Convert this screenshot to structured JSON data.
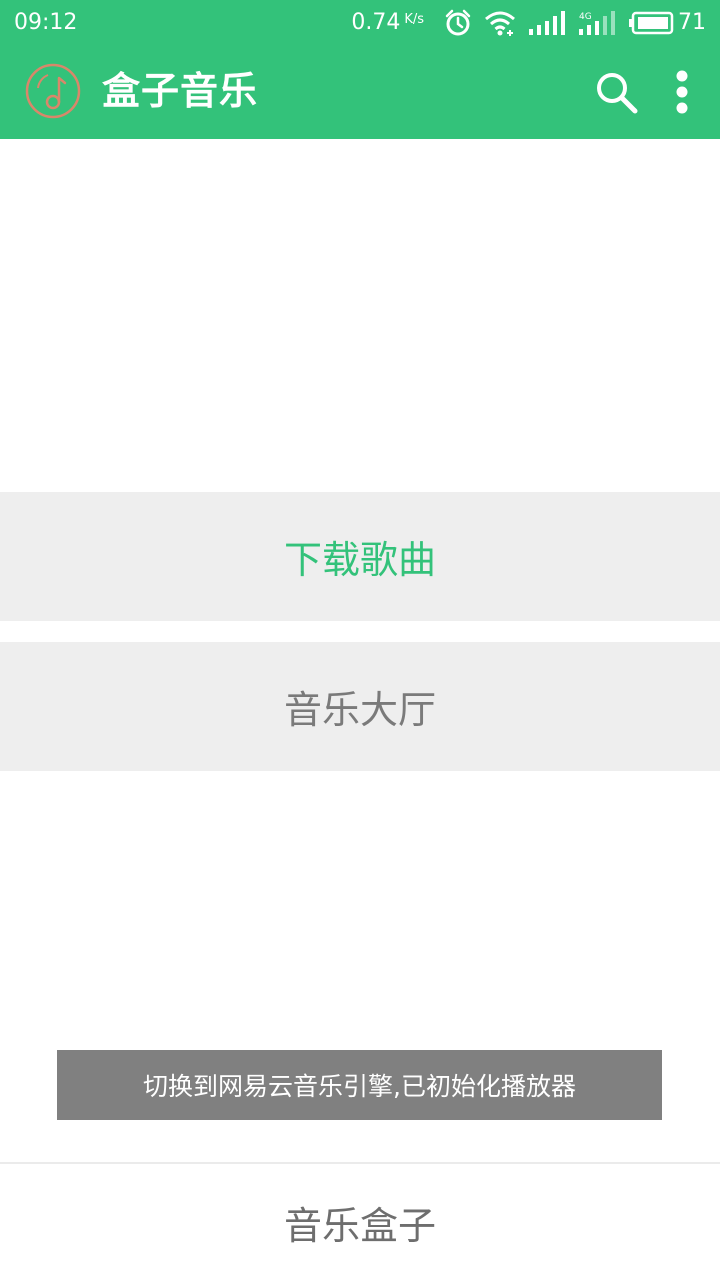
{
  "status_bar": {
    "time": "09:12",
    "net_speed": "0.74",
    "net_speed_unit": "K/s",
    "battery_level": "71",
    "icons": [
      "alarm-icon",
      "wifi-icon",
      "signal-icon",
      "signal-4g-icon",
      "battery-icon"
    ]
  },
  "toolbar": {
    "title": "盒子音乐",
    "logo_icon": "music-note-icon",
    "actions": [
      "search-icon",
      "more-vert-icon"
    ]
  },
  "menu": {
    "download": "下载歌曲",
    "hall": "音乐大厅"
  },
  "toast": {
    "message": "切换到网易云音乐引擎,已初始化播放器"
  },
  "footer": {
    "label": "音乐盒子"
  },
  "colors": {
    "accent": "#33c27a",
    "row_background": "#eeeeee",
    "toast_background": "#808080",
    "logo_color": "#d9876a"
  }
}
